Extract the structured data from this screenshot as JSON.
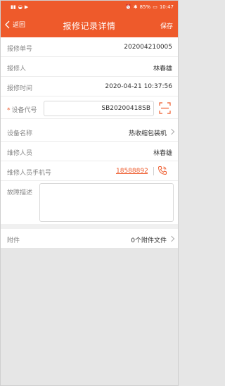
{
  "status_bar": {
    "battery": "85%",
    "time": "10:47"
  },
  "nav": {
    "back_label": "返回",
    "title": "报修记录详情",
    "save_label": "保存"
  },
  "fields": {
    "repair_no": {
      "label": "报修单号",
      "value": "202004210005"
    },
    "reporter": {
      "label": "报修人",
      "value": "林春雄"
    },
    "report_time": {
      "label": "报修时间",
      "value": "2020-04-21 10:37:56"
    },
    "device_code": {
      "required_mark": "*",
      "label": "设备代号",
      "value": "SB20200418SB"
    },
    "device_name": {
      "label": "设备名称",
      "value": "热收缩包装机"
    },
    "repairer": {
      "label": "维修人员",
      "value": "林春雄"
    },
    "repairer_phone": {
      "label": "维修人员手机号",
      "value": "18588892"
    },
    "fault_desc": {
      "label": "故障描述",
      "value": ""
    }
  },
  "attachment": {
    "label": "附件",
    "value": "0个附件文件"
  },
  "icons": {
    "back": "chevron-left-icon",
    "scan": "scan-icon",
    "phone": "phone-icon"
  },
  "colors": {
    "accent": "#ee5a2b",
    "background": "#e6e6e6"
  }
}
